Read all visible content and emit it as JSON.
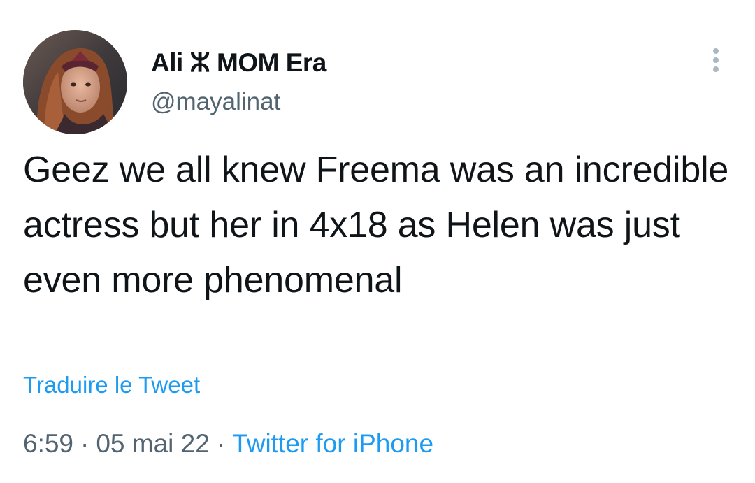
{
  "tweet": {
    "author": {
      "display_name": "Ali ⵣ MOM Era",
      "handle": "@mayalinat"
    },
    "text": "Geez we all knew Freema was an incredible actress but her in 4x18 as Helen was just even more phenomenal",
    "translate_label": "Traduire le Tweet",
    "meta": {
      "time": "6:59",
      "separator": "·",
      "date": "05 mai 22",
      "source": "Twitter for iPhone"
    }
  },
  "icons": {
    "more": "more-vertical-icon"
  },
  "colors": {
    "text_primary": "#0f1419",
    "text_secondary": "#536471",
    "link": "#1d9bf0",
    "divider": "#e6ecf0",
    "more_dots": "#aab8c2"
  }
}
